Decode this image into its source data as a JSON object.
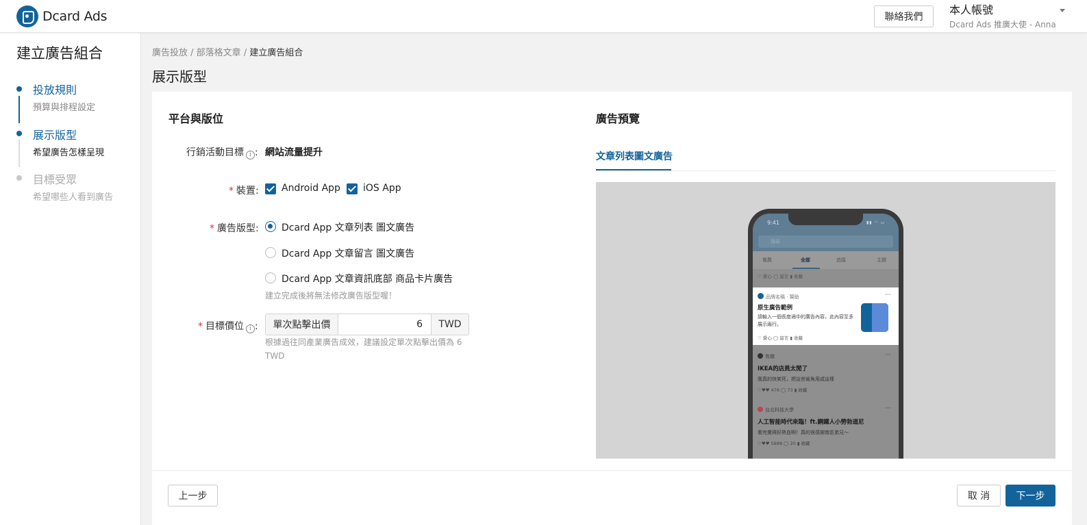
{
  "header": {
    "logo_text": "Dcard Ads",
    "contact_label": "聯絡我們",
    "account_name": "本人帳號",
    "account_sub": "Dcard Ads 推廣大使 - Anna"
  },
  "sidebar": {
    "title": "建立廣告組合",
    "steps": [
      {
        "label": "投放規則",
        "desc": "預算與排程設定"
      },
      {
        "label": "展示版型",
        "desc": "希望廣告怎樣呈現"
      },
      {
        "label": "目標受眾",
        "desc": "希望哪些人看到廣告"
      }
    ]
  },
  "breadcrumb": {
    "items": [
      "廣告投放",
      "部落格文章",
      "建立廣告組合"
    ],
    "separator": " / "
  },
  "page_title": "展示版型",
  "form": {
    "section_title": "平台與版位",
    "goal_label": "行銷活動目標",
    "goal_value": "網站流量提升",
    "device_label": "裝置",
    "devices": [
      {
        "label": "Android App",
        "checked": true
      },
      {
        "label": "iOS App",
        "checked": true
      }
    ],
    "format_label": "廣告版型",
    "formats": [
      {
        "label": "Dcard App 文章列表 圖文廣告",
        "selected": true
      },
      {
        "label": "Dcard App 文章留言 圖文廣告",
        "selected": false
      },
      {
        "label": "Dcard App 文章資訊底部 商品卡片廣告",
        "selected": false
      }
    ],
    "format_hint": "建立完成後將無法修改廣告版型喔！",
    "bid_label": "目標價位",
    "bid_prefix": "單次點擊出價",
    "bid_value": "6",
    "bid_suffix": "TWD",
    "bid_hint_line1": "根據過往同產業廣告成效，建議設定單次點擊出價為 6",
    "bid_hint_line2": "TWD",
    "colon": ":",
    "required_mark": "*"
  },
  "preview": {
    "title": "廣告預覽",
    "tab_label": "文章列表圖文廣告",
    "phone": {
      "time": "9:41",
      "search_placeholder": "搜尋",
      "tabs": [
        "推薦",
        "全部",
        "追蹤",
        "主題"
      ],
      "actions_top": "♡ 愛心   ◯ 留言   ▮ 收藏",
      "ad": {
        "brand": "品牌名稱 · 贊助",
        "title": "原生廣告範例",
        "body": "請輸入一個長度適中的廣告內容，此內容至多展示兩行。",
        "actions": "♡ 愛心   ◯ 留言   ▮ 收藏"
      },
      "posts": [
        {
          "board": "有趣",
          "title": "IKEA的店員太閒了",
          "body": "我真的快笑死，把這些鯊魚用成這樣",
          "actions": "♡♥♥ 476   ◯ 73   ▮ 收藏"
        },
        {
          "board": "台北科技大學",
          "title": "人工智能時代來臨！ft.鋼鐵人小勞勃道尼",
          "body": "看完覺得好熱血啊！真的很感謝南臣弟兄～",
          "actions": "♡♥♥ 5888   ◯ 20   ▮ 收藏"
        }
      ]
    }
  },
  "footer": {
    "prev_label": "上一步",
    "cancel_label": "取 消",
    "next_label": "下一步"
  },
  "colors": {
    "primary": "#13639b",
    "required": "#d93025"
  }
}
